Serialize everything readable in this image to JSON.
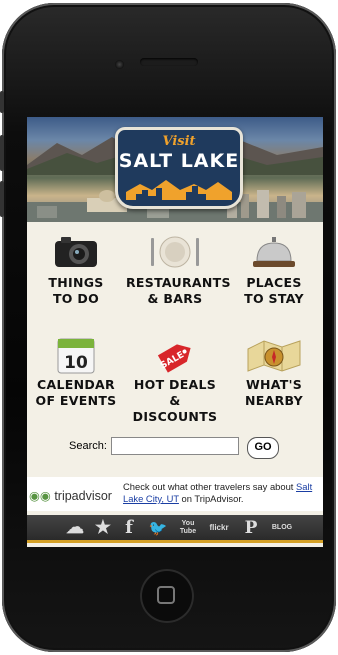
{
  "banner": {
    "visit": "Visit",
    "city_name": "SALT LAKE"
  },
  "menu": [
    {
      "line1": "THINGS",
      "line2": "TO DO",
      "icon": "camera-icon"
    },
    {
      "line1": "RESTAURANTS",
      "line2": "& BARS",
      "icon": "plate-icon"
    },
    {
      "line1": "PLACES",
      "line2": "TO STAY",
      "icon": "service-bell-icon"
    },
    {
      "line1": "CALENDAR",
      "line2": "OF EVENTS",
      "icon": "calendar-icon"
    },
    {
      "line1": "HOT DEALS &",
      "line2": "DISCOUNTS",
      "icon": "sale-tag-icon"
    },
    {
      "line1": "WHAT'S",
      "line2": "NEARBY",
      "icon": "map-compass-icon"
    }
  ],
  "calendar_day": "10",
  "sale_tag_text": "SALE",
  "search": {
    "label": "Search:",
    "value": "",
    "go_label": "GO"
  },
  "tripadvisor": {
    "logo": "tripadvisor",
    "text_before": "Check out what other travelers say about ",
    "link": "Salt Lake City, UT",
    "text_after": " on TripAdvisor."
  },
  "social_icons": [
    {
      "name": "weather-icon",
      "glyph": "☁"
    },
    {
      "name": "star-icon",
      "glyph": "★"
    },
    {
      "name": "facebook-icon",
      "glyph": "f"
    },
    {
      "name": "twitter-icon",
      "glyph": "🐦"
    },
    {
      "name": "youtube-icon",
      "glyph": "You Tube"
    },
    {
      "name": "flickr-icon",
      "glyph": "flickr"
    },
    {
      "name": "pinterest-icon",
      "glyph": "P"
    },
    {
      "name": "blog-icon",
      "glyph": "BLOG"
    }
  ],
  "colors": {
    "accent_gold": "#d4a026",
    "shield_blue": "#1f3a5d",
    "tripadvisor_green": "#589442",
    "link_blue": "#1a3ea3"
  }
}
